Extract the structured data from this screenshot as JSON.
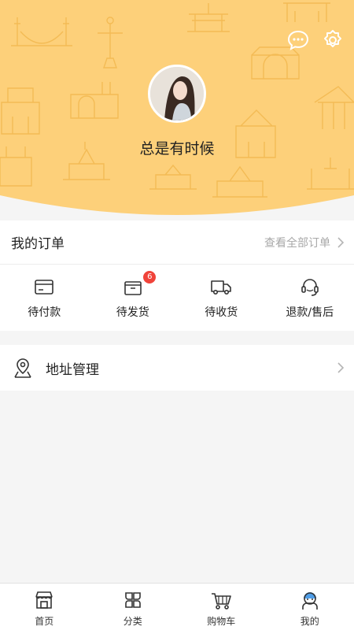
{
  "header": {
    "username": "总是有时候",
    "bg_color": "#fdd07a",
    "line_color": "#f2b84f",
    "icons": [
      "chat-icon",
      "settings-icon"
    ]
  },
  "orders": {
    "title": "我的订单",
    "view_all": "查看全部订单",
    "statuses": [
      {
        "label": "待付款",
        "icon": "card-icon"
      },
      {
        "label": "待发货",
        "icon": "package-icon",
        "badge": "6"
      },
      {
        "label": "待收货",
        "icon": "truck-icon"
      },
      {
        "label": "退款/售后",
        "icon": "headset-icon"
      }
    ]
  },
  "address": {
    "label": "地址管理",
    "icon": "location-pin-icon"
  },
  "tabbar": {
    "tabs": [
      {
        "label": "首页",
        "icon": "store-icon"
      },
      {
        "label": "分类",
        "icon": "category-icon"
      },
      {
        "label": "购物车",
        "icon": "cart-icon"
      },
      {
        "label": "我的",
        "icon": "profile-icon"
      }
    ],
    "badge_color": "#f0433a"
  }
}
